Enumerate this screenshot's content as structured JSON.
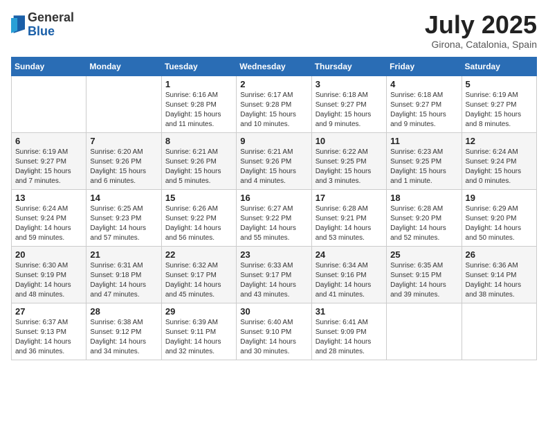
{
  "header": {
    "logo_general": "General",
    "logo_blue": "Blue",
    "month_title": "July 2025",
    "location": "Girona, Catalonia, Spain"
  },
  "weekdays": [
    "Sunday",
    "Monday",
    "Tuesday",
    "Wednesday",
    "Thursday",
    "Friday",
    "Saturday"
  ],
  "weeks": [
    [
      {
        "day": "",
        "info": ""
      },
      {
        "day": "",
        "info": ""
      },
      {
        "day": "1",
        "info": "Sunrise: 6:16 AM\nSunset: 9:28 PM\nDaylight: 15 hours\nand 11 minutes."
      },
      {
        "day": "2",
        "info": "Sunrise: 6:17 AM\nSunset: 9:28 PM\nDaylight: 15 hours\nand 10 minutes."
      },
      {
        "day": "3",
        "info": "Sunrise: 6:18 AM\nSunset: 9:27 PM\nDaylight: 15 hours\nand 9 minutes."
      },
      {
        "day": "4",
        "info": "Sunrise: 6:18 AM\nSunset: 9:27 PM\nDaylight: 15 hours\nand 9 minutes."
      },
      {
        "day": "5",
        "info": "Sunrise: 6:19 AM\nSunset: 9:27 PM\nDaylight: 15 hours\nand 8 minutes."
      }
    ],
    [
      {
        "day": "6",
        "info": "Sunrise: 6:19 AM\nSunset: 9:27 PM\nDaylight: 15 hours\nand 7 minutes."
      },
      {
        "day": "7",
        "info": "Sunrise: 6:20 AM\nSunset: 9:26 PM\nDaylight: 15 hours\nand 6 minutes."
      },
      {
        "day": "8",
        "info": "Sunrise: 6:21 AM\nSunset: 9:26 PM\nDaylight: 15 hours\nand 5 minutes."
      },
      {
        "day": "9",
        "info": "Sunrise: 6:21 AM\nSunset: 9:26 PM\nDaylight: 15 hours\nand 4 minutes."
      },
      {
        "day": "10",
        "info": "Sunrise: 6:22 AM\nSunset: 9:25 PM\nDaylight: 15 hours\nand 3 minutes."
      },
      {
        "day": "11",
        "info": "Sunrise: 6:23 AM\nSunset: 9:25 PM\nDaylight: 15 hours\nand 1 minute."
      },
      {
        "day": "12",
        "info": "Sunrise: 6:24 AM\nSunset: 9:24 PM\nDaylight: 15 hours\nand 0 minutes."
      }
    ],
    [
      {
        "day": "13",
        "info": "Sunrise: 6:24 AM\nSunset: 9:24 PM\nDaylight: 14 hours\nand 59 minutes."
      },
      {
        "day": "14",
        "info": "Sunrise: 6:25 AM\nSunset: 9:23 PM\nDaylight: 14 hours\nand 57 minutes."
      },
      {
        "day": "15",
        "info": "Sunrise: 6:26 AM\nSunset: 9:22 PM\nDaylight: 14 hours\nand 56 minutes."
      },
      {
        "day": "16",
        "info": "Sunrise: 6:27 AM\nSunset: 9:22 PM\nDaylight: 14 hours\nand 55 minutes."
      },
      {
        "day": "17",
        "info": "Sunrise: 6:28 AM\nSunset: 9:21 PM\nDaylight: 14 hours\nand 53 minutes."
      },
      {
        "day": "18",
        "info": "Sunrise: 6:28 AM\nSunset: 9:20 PM\nDaylight: 14 hours\nand 52 minutes."
      },
      {
        "day": "19",
        "info": "Sunrise: 6:29 AM\nSunset: 9:20 PM\nDaylight: 14 hours\nand 50 minutes."
      }
    ],
    [
      {
        "day": "20",
        "info": "Sunrise: 6:30 AM\nSunset: 9:19 PM\nDaylight: 14 hours\nand 48 minutes."
      },
      {
        "day": "21",
        "info": "Sunrise: 6:31 AM\nSunset: 9:18 PM\nDaylight: 14 hours\nand 47 minutes."
      },
      {
        "day": "22",
        "info": "Sunrise: 6:32 AM\nSunset: 9:17 PM\nDaylight: 14 hours\nand 45 minutes."
      },
      {
        "day": "23",
        "info": "Sunrise: 6:33 AM\nSunset: 9:17 PM\nDaylight: 14 hours\nand 43 minutes."
      },
      {
        "day": "24",
        "info": "Sunrise: 6:34 AM\nSunset: 9:16 PM\nDaylight: 14 hours\nand 41 minutes."
      },
      {
        "day": "25",
        "info": "Sunrise: 6:35 AM\nSunset: 9:15 PM\nDaylight: 14 hours\nand 39 minutes."
      },
      {
        "day": "26",
        "info": "Sunrise: 6:36 AM\nSunset: 9:14 PM\nDaylight: 14 hours\nand 38 minutes."
      }
    ],
    [
      {
        "day": "27",
        "info": "Sunrise: 6:37 AM\nSunset: 9:13 PM\nDaylight: 14 hours\nand 36 minutes."
      },
      {
        "day": "28",
        "info": "Sunrise: 6:38 AM\nSunset: 9:12 PM\nDaylight: 14 hours\nand 34 minutes."
      },
      {
        "day": "29",
        "info": "Sunrise: 6:39 AM\nSunset: 9:11 PM\nDaylight: 14 hours\nand 32 minutes."
      },
      {
        "day": "30",
        "info": "Sunrise: 6:40 AM\nSunset: 9:10 PM\nDaylight: 14 hours\nand 30 minutes."
      },
      {
        "day": "31",
        "info": "Sunrise: 6:41 AM\nSunset: 9:09 PM\nDaylight: 14 hours\nand 28 minutes."
      },
      {
        "day": "",
        "info": ""
      },
      {
        "day": "",
        "info": ""
      }
    ]
  ]
}
